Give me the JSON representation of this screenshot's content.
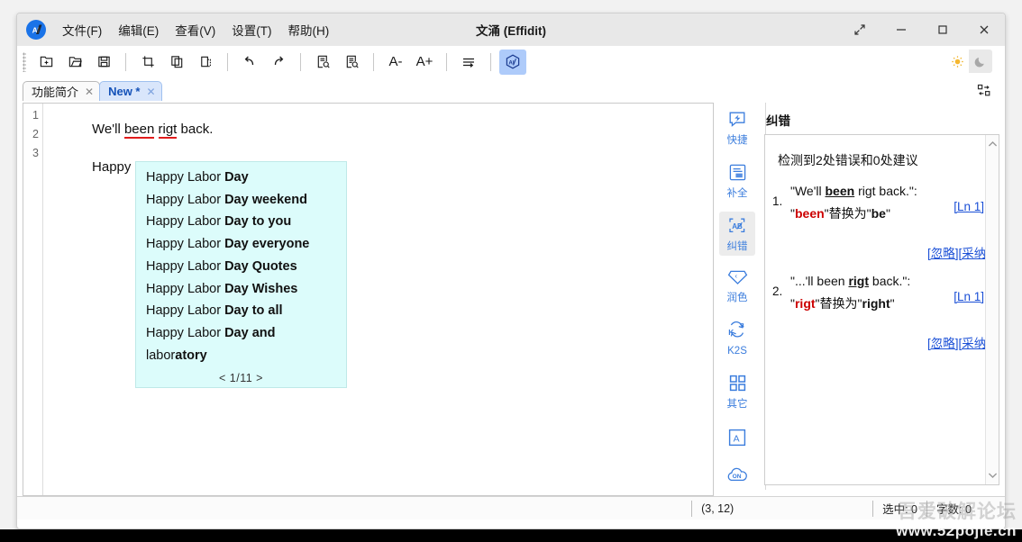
{
  "window": {
    "title": "文涌 (Effidit)",
    "logo_text": "AI"
  },
  "menubar": {
    "items": [
      {
        "label": "文件(F)",
        "name": "menu-file"
      },
      {
        "label": "编辑(E)",
        "name": "menu-edit"
      },
      {
        "label": "查看(V)",
        "name": "menu-view"
      },
      {
        "label": "设置(T)",
        "name": "menu-settings"
      },
      {
        "label": "帮助(H)",
        "name": "menu-help"
      }
    ]
  },
  "window_controls": {
    "expand": "⤢",
    "minimize": "—",
    "maximize": "□",
    "close": "✕"
  },
  "toolbar": {
    "groups": [
      [
        "new-file-icon",
        "open-folder-icon",
        "save-icon"
      ],
      [
        "cut-icon",
        "copy-icon",
        "paste-icon"
      ],
      [
        "undo-icon",
        "redo-icon"
      ],
      [
        "find-icon",
        "replace-icon"
      ],
      [
        "decrease-font-icon",
        "increase-font-icon"
      ],
      [
        "line-spacing-icon"
      ],
      [
        "ai-assist-icon"
      ]
    ],
    "font_smaller_label": "A-",
    "font_larger_label": "A+",
    "ai_label": "AI",
    "theme_light": "☀",
    "theme_dark": "☾"
  },
  "tabs": [
    {
      "label": "功能简介",
      "close": "✕",
      "selected": false
    },
    {
      "label": "New *",
      "close": "✕",
      "selected": true
    }
  ],
  "editor": {
    "lines": [
      {
        "num": "1",
        "segments": [
          {
            "text": "We'll ",
            "error": false
          },
          {
            "text": "been",
            "error": true
          },
          {
            "text": " ",
            "error": false
          },
          {
            "text": "rigt",
            "error": true
          },
          {
            "text": " back.",
            "error": false
          }
        ]
      },
      {
        "num": "2",
        "segments": []
      },
      {
        "num": "3",
        "segments": [
          {
            "text": "Happy labor",
            "error": false
          }
        ]
      }
    ]
  },
  "autocomplete": {
    "items": [
      {
        "prefix": "Happy Labor ",
        "suffix": "Day"
      },
      {
        "prefix": "Happy Labor ",
        "suffix": "Day weekend"
      },
      {
        "prefix": "Happy Labor ",
        "suffix": "Day to you"
      },
      {
        "prefix": "Happy Labor ",
        "suffix": "Day everyone"
      },
      {
        "prefix": "Happy Labor ",
        "suffix": "Day Quotes"
      },
      {
        "prefix": "Happy Labor ",
        "suffix": "Day Wishes"
      },
      {
        "prefix": "Happy Labor ",
        "suffix": "Day to all"
      },
      {
        "prefix": "Happy Labor ",
        "suffix": "Day and"
      },
      {
        "prefix": "labor",
        "suffix": "atory"
      }
    ],
    "pager": "< 1/11 >",
    "prev": "<",
    "page": "1/11",
    "next": ">"
  },
  "rail": {
    "items": [
      {
        "label": "快捷",
        "icon": "lightning-box-icon",
        "selected": false
      },
      {
        "label": "补全",
        "icon": "document-complete-icon",
        "selected": false
      },
      {
        "label": "纠错",
        "icon": "text-correct-icon",
        "selected": true
      },
      {
        "label": "润色",
        "icon": "diamond-polish-icon",
        "selected": false
      },
      {
        "label": "K2S",
        "icon": "k2s-icon",
        "selected": false
      },
      {
        "label": "其它",
        "icon": "grid-four-icon",
        "selected": false
      }
    ],
    "extra": [
      {
        "icon": "letter-a-box-icon",
        "label": "A"
      },
      {
        "icon": "cloud-on-icon",
        "label": "ON"
      }
    ]
  },
  "correction": {
    "panel_title": "纠错",
    "summary": "检测到2处错误和0处建议",
    "items": [
      {
        "num": "1.",
        "quote_pre": "\"We'll ",
        "quote_err": "been",
        "quote_post": " rigt back.\":",
        "fix_pre": "\"",
        "fix_bad": "been",
        "fix_mid": "\"替换为\"",
        "fix_good": "be",
        "fix_post": "\"",
        "line_link": "[Ln 1]",
        "ignore": "[忽略]",
        "accept": "[采纳]"
      },
      {
        "num": "2.",
        "quote_pre": "\"...'ll been ",
        "quote_err": "rigt",
        "quote_post": " back.\":",
        "fix_pre": "\"",
        "fix_bad": "rigt",
        "fix_mid": "\"替换为\"",
        "fix_good": "right",
        "fix_post": "\"",
        "line_link": "[Ln 1]",
        "ignore": "[忽略]",
        "accept": "[采纳]"
      }
    ],
    "scroll_up": "⌃",
    "scroll_down": "⌄"
  },
  "statusbar": {
    "position": "(3, 12)",
    "selection": "选中: 0",
    "right_extra": "字数: 0"
  },
  "watermark": {
    "cn": "吾爱破解论坛",
    "en": "www.52pojie.cn"
  },
  "colors": {
    "accent": "#1a73e8",
    "tab_selected_bg": "#d9e6fb",
    "autocomplete_bg": "#dcfcfb",
    "error_red": "#cc0000",
    "link_blue": "#1a4fd6",
    "rail_blue": "#3b7ddd"
  }
}
